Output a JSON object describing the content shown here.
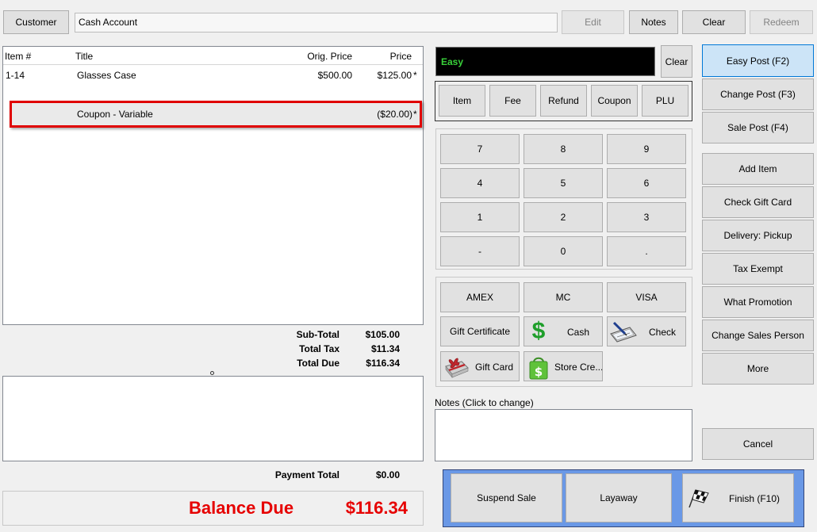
{
  "top": {
    "customer_label": "Customer",
    "account_value": "Cash Account",
    "edit_label": "Edit",
    "notes_label": "Notes",
    "clear_label": "Clear",
    "redeem_label": "Redeem"
  },
  "items_table": {
    "headers": {
      "item": "Item #",
      "title": "Title",
      "orig_price": "Orig. Price",
      "price": "Price"
    },
    "rows": [
      {
        "item": "1-14",
        "title": "Glasses Case",
        "orig_price": "$500.00",
        "price": "$125.00",
        "flag": "*"
      },
      {
        "item": "",
        "title": "Coupon - Variable",
        "orig_price": "",
        "price": "($20.00)",
        "flag": "*"
      }
    ]
  },
  "totals": {
    "subtotal_label": "Sub-Total",
    "subtotal_value": "$105.00",
    "tax_label": "Total Tax",
    "tax_value": "$11.34",
    "due_label": "Total Due",
    "due_value": "$116.34",
    "payment_label": "Payment Total",
    "payment_value": "$0.00",
    "balance_label": "Balance Due",
    "balance_value": "$116.34"
  },
  "entry": {
    "mode_text": "Easy",
    "clear_label": "Clear"
  },
  "type_buttons": [
    "Item",
    "Fee",
    "Refund",
    "Coupon",
    "PLU"
  ],
  "keypad": [
    "7",
    "8",
    "9",
    "4",
    "5",
    "6",
    "1",
    "2",
    "3",
    "-",
    "0",
    "."
  ],
  "tenders": {
    "amex": "AMEX",
    "mc": "MC",
    "visa": "VISA",
    "gift_certificate": "Gift Certificate",
    "cash": "Cash",
    "check": "Check",
    "gift_card": "Gift Card",
    "store_credit": "Store Cre..."
  },
  "notes": {
    "label": "Notes (Click to change)",
    "value": ""
  },
  "bottom_buttons": {
    "suspend": "Suspend Sale",
    "layaway": "Layaway",
    "finish": "Finish (F10)"
  },
  "side_buttons": {
    "easy_post": "Easy Post (F2)",
    "change_post": "Change Post (F3)",
    "sale_post": "Sale Post (F4)",
    "add_item": "Add Item",
    "check_gift_card": "Check Gift Card",
    "delivery": "Delivery: Pickup",
    "tax_exempt": "Tax Exempt",
    "what_promotion": "What Promotion",
    "change_sales_person": "Change Sales Person",
    "more": "More",
    "cancel": "Cancel"
  },
  "colors": {
    "highlight_border": "#e00000",
    "balance_red": "#e60000",
    "entry_green": "#39d13a",
    "bottom_panel_blue": "#6a98e6",
    "active_button": "#cce4f7"
  }
}
